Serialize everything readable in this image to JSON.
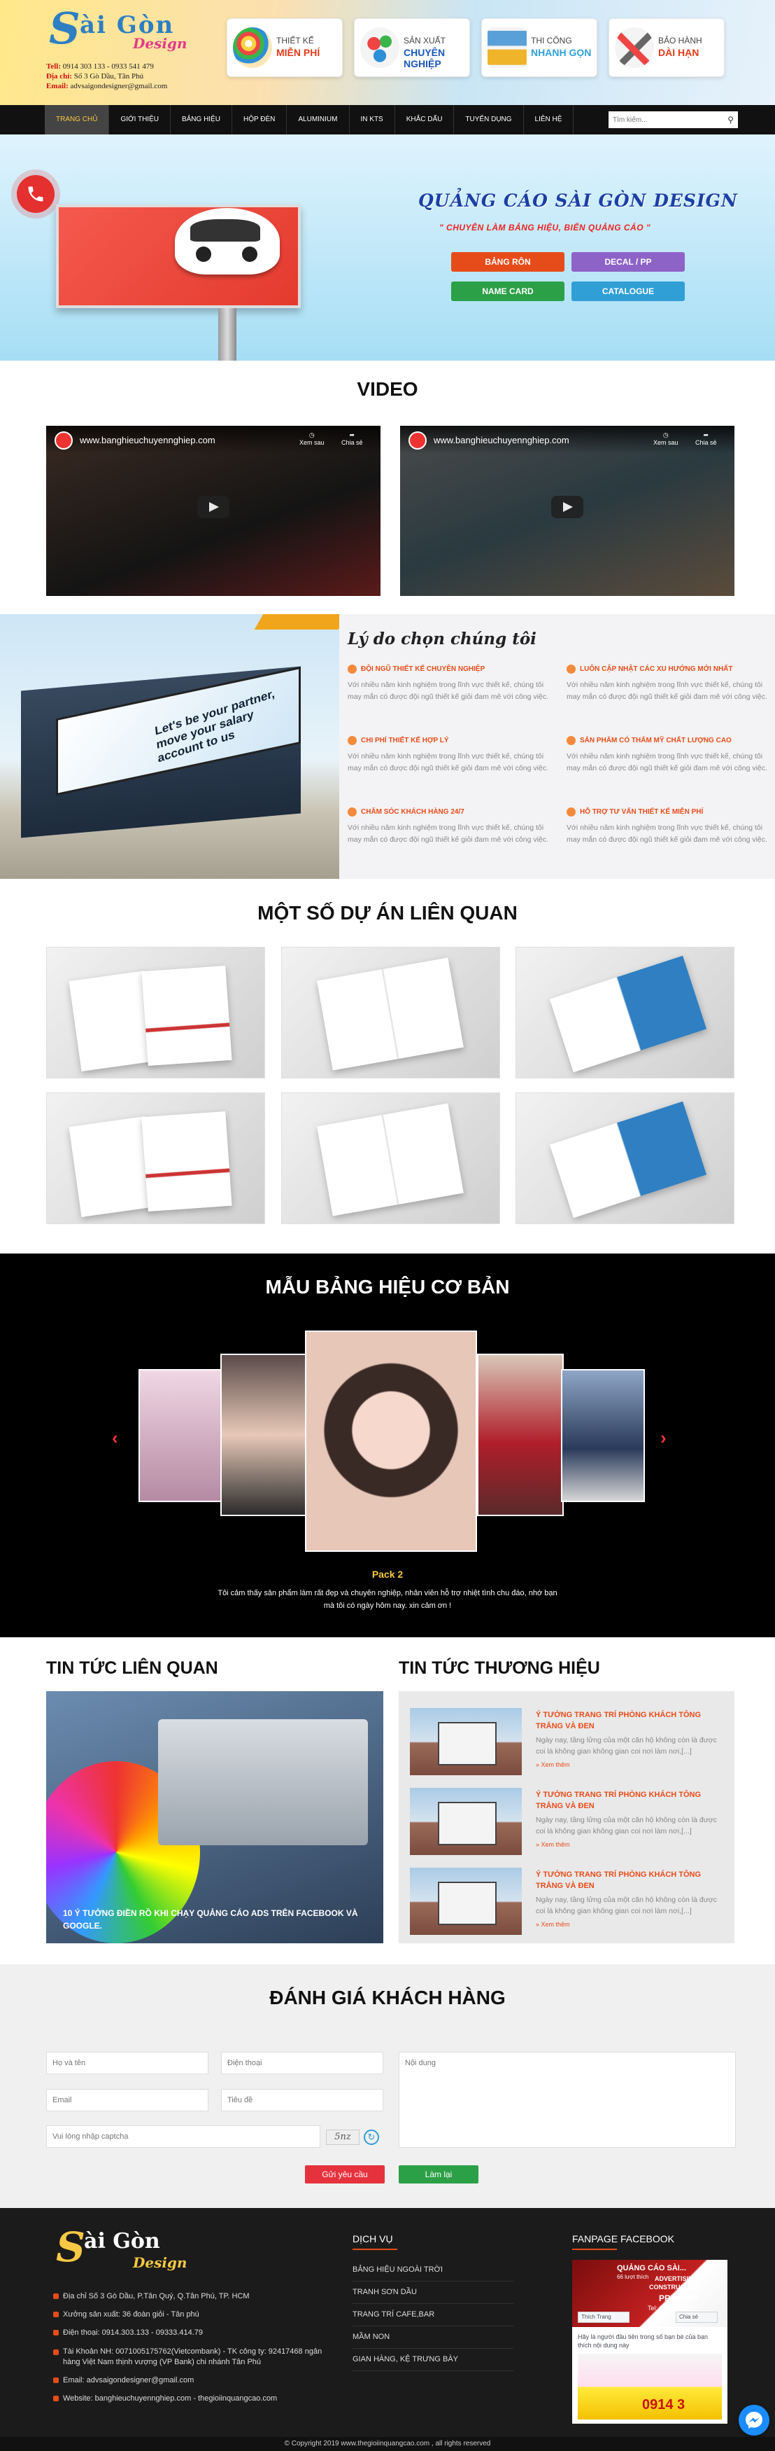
{
  "header": {
    "logo_s": "S",
    "logo_text": "ài Gòn",
    "logo_sub": "Design",
    "tel_label": "Tell:",
    "tel_value": "0914 303 133 - 0933 541 479",
    "addr_label": "Địa chỉ:",
    "addr_value": "Số 3 Gò Dầu, Tân Phú",
    "email_label": "Email:",
    "email_value": "advsaigondesigner@gmail.com",
    "features": [
      {
        "line1": "THIẾT KẾ",
        "line2": "MIỄN PHÍ",
        "icon": "palette-icon"
      },
      {
        "line1": "SẢN XUẤT",
        "line2": "CHUYÊN NGHIỆP",
        "icon": "gears-icon"
      },
      {
        "line1": "THI CÔNG",
        "line2": "NHANH GỌN",
        "icon": "hourglass-icon"
      },
      {
        "line1": "BẢO HÀNH",
        "line2": "DÀI HẠN",
        "icon": "tools-icon"
      }
    ]
  },
  "nav": {
    "items": [
      "Trang chủ",
      "Giới thiệu",
      "Bảng hiệu",
      "Hộp đèn",
      "Aluminium",
      "In KTS",
      "Khắc dấu",
      "Tuyển dụng",
      "Liên hệ"
    ],
    "active": "Trang chủ",
    "search_placeholder": "Tìm kiếm..."
  },
  "banner": {
    "title": "QUẢNG CÁO SÀI GÒN DESIGN",
    "subtitle": "\" CHUYÊN LÀM BẢNG HIỆU, BIỂN QUẢNG CÁO \"",
    "buttons": [
      {
        "label": "BẢNG RÔN",
        "color": "#e64c1a"
      },
      {
        "label": "DECAL / PP",
        "color": "#8e63c7"
      },
      {
        "label": "NAME CARD",
        "color": "#2ca046"
      },
      {
        "label": "CATALOGUE",
        "color": "#2f9fd6"
      }
    ]
  },
  "video": {
    "title": "VIDEO",
    "items": [
      {
        "title": "www.banghieuchuyennghiep.com",
        "watch_later": "Xem sau",
        "share": "Chia sẻ"
      },
      {
        "title": "www.banghieuchuyennghiep.com",
        "watch_later": "Xem sau",
        "share": "Chia sẻ"
      }
    ]
  },
  "why": {
    "title": "Lý do chọn chúng tôi",
    "billboard_text": "Let's be your partner, move your salary account to us",
    "items": [
      {
        "heading": "ĐỘI NGŨ THIẾT KẾ CHUYÊN NGHIỆP",
        "text": "Với nhiều năm kinh nghiệm trong lĩnh vực thiết kế, chúng tôi may mắn có được đội ngũ thiết kế giỏi đam mê với công việc."
      },
      {
        "heading": "LUÔN CẬP NHẬT CÁC XU HƯỚNG MỚI NHẤT",
        "text": "Với nhiều năm kinh nghiệm trong lĩnh vực thiết kế, chúng tôi may mắn có được đội ngũ thiết kế giỏi đam mê với công việc."
      },
      {
        "heading": "CHI PHÍ THIẾT KẾ HỢP LÝ",
        "text": "Với nhiều năm kinh nghiệm trong lĩnh vực thiết kế, chúng tôi may mắn có được đội ngũ thiết kế giỏi đam mê với công việc."
      },
      {
        "heading": "SẢN PHẨM CÓ THẨM MỸ CHẤT LƯỢNG CAO",
        "text": "Với nhiều năm kinh nghiệm trong lĩnh vực thiết kế, chúng tôi may mắn có được đội ngũ thiết kế giỏi đam mê với công việc."
      },
      {
        "heading": "CHĂM SÓC KHÁCH HÀNG 24/7",
        "text": "Với nhiều năm kinh nghiệm trong lĩnh vực thiết kế, chúng tôi may mắn có được đội ngũ thiết kế giỏi đam mê với công việc."
      },
      {
        "heading": "HỖ TRỢ TƯ VẤN THIẾT KẾ MIỄN PHÍ",
        "text": "Với nhiều năm kinh nghiệm trong lĩnh vực thiết kế, chúng tôi may mắn có được đội ngũ thiết kế giỏi đam mê với công việc."
      }
    ]
  },
  "projects": {
    "title": "MỘT SỐ DỰ ÁN LIÊN QUAN"
  },
  "signs": {
    "title": "MẪU BẢNG HIỆU CƠ BẢN",
    "pack": "Pack 2",
    "quote": "Tôi cảm thấy sản phẩm làm rất đẹp và chuyên nghiệp, nhân viên hỗ trợ nhiệt tình chu đáo, nhớ bạn mà tôi có ngày hôm nay. xin cảm ơn !"
  },
  "news": {
    "left_title": "TIN TỨC LIÊN QUAN",
    "right_title": "TIN TỨC THƯƠNG HIỆU",
    "main_caption": "10 Ý TƯỞNG ĐIỀN RỒ KHI CHẠY QUẢNG CÁO ADS TRÊN FACEBOOK VÀ GOOGLE.",
    "items": [
      {
        "title": "Ý TƯỞNG TRANG TRÍ PHÒNG KHÁCH TÔNG TRẮNG VÀ ĐEN",
        "desc": "Ngày nay, tầng lửng của một căn hộ không còn là được coi là không gian không gian coi nơi làm nơi,[...]",
        "more": "» Xem thêm"
      },
      {
        "title": "Ý TƯỞNG TRANG TRÍ PHÒNG KHÁCH TÔNG TRẮNG VÀ ĐEN",
        "desc": "Ngày nay, tầng lửng của một căn hộ không còn là được coi là không gian không gian coi nơi làm nơi,[...]",
        "more": "» Xem thêm"
      },
      {
        "title": "Ý TƯỞNG TRANG TRÍ PHÒNG KHÁCH TÔNG TRẮNG VÀ ĐEN",
        "desc": "Ngày nay, tầng lửng của một căn hộ không còn là được coi là không gian không gian coi nơi làm nơi,[...]",
        "more": "» Xem thêm"
      }
    ]
  },
  "review": {
    "title": "ĐÁNH GIÁ KHÁCH HÀNG",
    "name_ph": "Họ và tên",
    "phone_ph": "Điện thoại",
    "email_ph": "Email",
    "subject_ph": "Tiêu đề",
    "content_ph": "Nội dung",
    "captcha_ph": "Vui lòng nhập captcha",
    "captcha_code": "5nz",
    "send_label": "Gửi yêu cầu",
    "reset_label": "Làm lại"
  },
  "footer": {
    "logo_text": "ài Gòn",
    "logo_s": "S",
    "logo_sub": "Design",
    "lines": [
      "Địa chỉ Số 3 Gò Dầu, P.Tân Quý, Q.Tân Phú, TP. HCM",
      "Xưởng sản xuất: 36 đoàn giỏi - Tân phú",
      "Điện thoại: 0914.303.133 - 09333.414.79",
      "Tài Khoản NH: 0071005175762(Vietcombank) - TK công ty: 92417468 ngân hàng Việt Nam thịnh vượng (VP Bank) chi nhánh Tân Phú",
      "Email: advsaigondesigner@gmail.com",
      "Website: banghieuchuyennghiep.com - thegioiinquangcao.com"
    ],
    "services_title": "DỊCH VỤ",
    "services": [
      "BẢNG HIỆU NGOÀI TRỜI",
      "TRANH SƠN DẦU",
      "TRANG TRÍ CAFE,BAR",
      "MẦM NON",
      "GIAN HÀNG, KỆ TRƯNG BÀY"
    ],
    "fanpage_title": "FANPAGE FACEBOOK",
    "fb_page_name": "QUẢNG CÁO SÀI...",
    "fb_likes": "66 lượt thích",
    "fb_like_btn": "Thích Trang",
    "fb_share_btn": "Chia sẻ",
    "fb_ad": "PRINTING",
    "fb_ad2": "ADVERTISING",
    "fb_ad3": "CONSTRUCTION",
    "fb_post": "Hãy là người đầu tiên trong số bạn bè của bạn thích nội dung này",
    "fb_phone": "0914 3",
    "fb_ad_line": "Tel: 08 620 7417",
    "copyright": "© Copyright 2019 www.thegioiinquangcao.com , all rights reserved"
  }
}
